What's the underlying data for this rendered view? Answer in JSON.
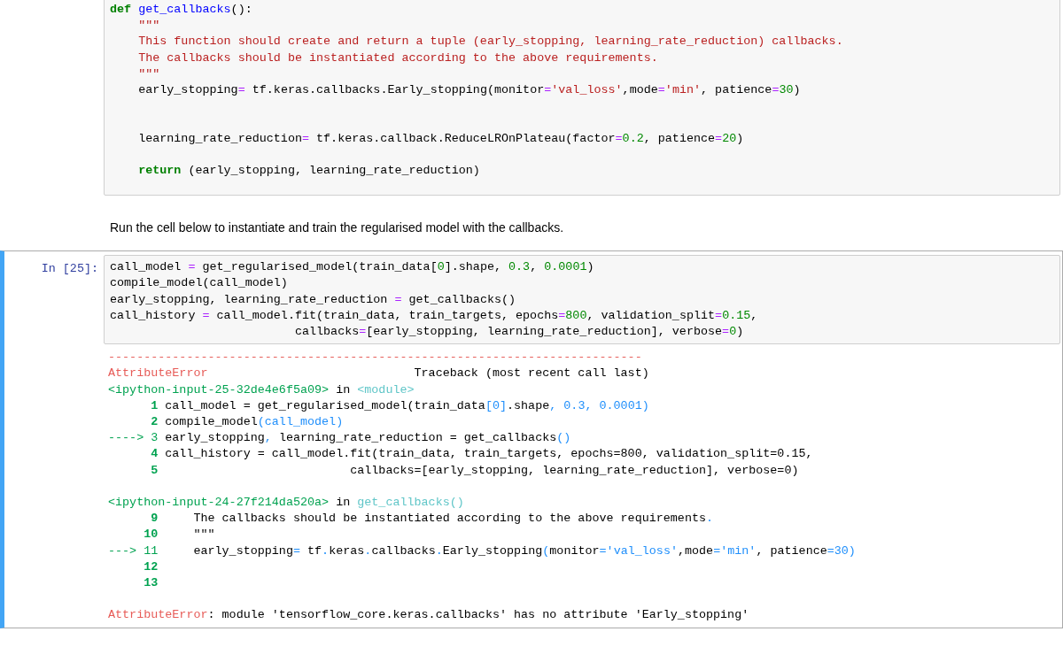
{
  "cells": [
    {
      "kind": "code",
      "selected": false,
      "lines": [
        {
          "kind": "code",
          "tokens": [
            {
              "t": "def",
              "kind": "kw"
            },
            {
              "t": " get_callbacks",
              "kind": "fn"
            },
            {
              "t": "():"
            }
          ]
        },
        {
          "kind": "code",
          "tokens": [
            {
              "t": "    \"\"\"",
              "kind": "str"
            }
          ]
        },
        {
          "kind": "code",
          "tokens": [
            {
              "t": "    This function should create and return a tuple (early_stopping, learning_rate_reduction) callbacks.",
              "kind": "str"
            }
          ]
        },
        {
          "kind": "code",
          "tokens": [
            {
              "t": "    The callbacks should be instantiated according to the above requirements.",
              "kind": "str"
            }
          ]
        },
        {
          "kind": "code",
          "tokens": [
            {
              "t": "    \"\"\"",
              "kind": "str"
            }
          ]
        },
        {
          "kind": "code",
          "tokens": [
            {
              "t": "    early_stopping"
            },
            {
              "t": "=",
              "kind": "op"
            },
            {
              "t": " tf.keras.callbacks.Early_stopping(monitor"
            },
            {
              "t": "=",
              "kind": "op"
            },
            {
              "t": "'val_loss'",
              "kind": "str"
            },
            {
              "t": ",mode"
            },
            {
              "t": "=",
              "kind": "op"
            },
            {
              "t": "'min'",
              "kind": "str"
            },
            {
              "t": ", patience"
            },
            {
              "t": "=",
              "kind": "op"
            },
            {
              "t": "30",
              "kind": "num"
            },
            {
              "t": ")"
            }
          ]
        },
        {
          "kind": "blank"
        },
        {
          "kind": "blank"
        },
        {
          "kind": "code",
          "tokens": [
            {
              "t": "    learning_rate_reduction"
            },
            {
              "t": "=",
              "kind": "op"
            },
            {
              "t": " tf.keras.callback.ReduceLROnPlateau(factor"
            },
            {
              "t": "=",
              "kind": "op"
            },
            {
              "t": "0.2",
              "kind": "num"
            },
            {
              "t": ", patience"
            },
            {
              "t": "=",
              "kind": "op"
            },
            {
              "t": "20",
              "kind": "num"
            },
            {
              "t": ")"
            }
          ]
        },
        {
          "kind": "blank"
        },
        {
          "kind": "code",
          "tokens": [
            {
              "t": "    return",
              "kind": "kw"
            },
            {
              "t": " (early_stopping, learning_rate_reduction)"
            }
          ]
        }
      ]
    },
    {
      "kind": "markdown",
      "text": "Run the cell below to instantiate and train the regularised model with the callbacks."
    },
    {
      "kind": "code",
      "selected": true,
      "prompt": "In [25]:",
      "lines": [
        {
          "kind": "code",
          "tokens": [
            {
              "t": "call_model "
            },
            {
              "t": "=",
              "kind": "op"
            },
            {
              "t": " get_regularised_model(train_data["
            },
            {
              "t": "0",
              "kind": "num"
            },
            {
              "t": "].shape, "
            },
            {
              "t": "0.3",
              "kind": "num"
            },
            {
              "t": ", "
            },
            {
              "t": "0.0001",
              "kind": "num"
            },
            {
              "t": ")"
            }
          ]
        },
        {
          "kind": "code",
          "tokens": [
            {
              "t": "compile_model(call_model)"
            }
          ]
        },
        {
          "kind": "code",
          "tokens": [
            {
              "t": "early_stopping, learning_rate_reduction "
            },
            {
              "t": "=",
              "kind": "op"
            },
            {
              "t": " get_callbacks()"
            }
          ]
        },
        {
          "kind": "code",
          "tokens": [
            {
              "t": "call_history "
            },
            {
              "t": "=",
              "kind": "op"
            },
            {
              "t": " call_model.fit(train_data, train_targets, epochs"
            },
            {
              "t": "=",
              "kind": "op"
            },
            {
              "t": "800",
              "kind": "num"
            },
            {
              "t": ", validation_split"
            },
            {
              "t": "=",
              "kind": "op"
            },
            {
              "t": "0.15",
              "kind": "num"
            },
            {
              "t": ","
            }
          ]
        },
        {
          "kind": "code",
          "tokens": [
            {
              "t": "                          callbacks"
            },
            {
              "t": "=",
              "kind": "op"
            },
            {
              "t": "[early_stopping, learning_rate_reduction], verbose"
            },
            {
              "t": "=",
              "kind": "op"
            },
            {
              "t": "0",
              "kind": "num"
            },
            {
              "t": ")"
            }
          ]
        }
      ],
      "output": [
        {
          "kind": "code",
          "tokens": [
            {
              "t": "---------------------------------------------------------------------------",
              "kind": "red"
            }
          ]
        },
        {
          "kind": "code",
          "tokens": [
            {
              "t": "AttributeError",
              "kind": "red"
            },
            {
              "t": "                             Traceback (most recent call last)"
            }
          ]
        },
        {
          "kind": "code",
          "tokens": [
            {
              "t": "<ipython-input-25-32de4e6f5a09>",
              "kind": "green"
            },
            {
              "t": " in "
            },
            {
              "t": "<module>",
              "kind": "cyan"
            }
          ]
        },
        {
          "kind": "code",
          "tokens": [
            {
              "t": "      1 ",
              "kind": "lineno"
            },
            {
              "t": "call_model = get_regularised_model(train_data"
            },
            {
              "t": "[0]",
              "kind": "blue"
            },
            {
              "t": ".shape"
            },
            {
              "t": ", 0.3, 0.0001)",
              "kind": "blue"
            }
          ]
        },
        {
          "kind": "code",
          "tokens": [
            {
              "t": "      2 ",
              "kind": "lineno"
            },
            {
              "t": "compile_model"
            },
            {
              "t": "(call_model)",
              "kind": "blue"
            }
          ]
        },
        {
          "kind": "code",
          "tokens": [
            {
              "t": "----> 3 ",
              "kind": "green"
            },
            {
              "t": "early_stopping"
            },
            {
              "t": ", ",
              "kind": "blue"
            },
            {
              "t": "learning_rate_reduction = get_callbacks"
            },
            {
              "t": "()",
              "kind": "blue"
            }
          ]
        },
        {
          "kind": "code",
          "tokens": [
            {
              "t": "      4 ",
              "kind": "lineno"
            },
            {
              "t": "call_history = call_model.fit(train_data, train_targets, epochs=800, validation_split=0.15,"
            }
          ]
        },
        {
          "kind": "code",
          "tokens": [
            {
              "t": "      5 ",
              "kind": "lineno"
            },
            {
              "t": "                          callbacks=[early_stopping, learning_rate_reduction], verbose=0)"
            }
          ]
        },
        {
          "kind": "blank"
        },
        {
          "kind": "code",
          "tokens": [
            {
              "t": "<ipython-input-24-27f214da520a>",
              "kind": "green"
            },
            {
              "t": " in "
            },
            {
              "t": "get_callbacks()",
              "kind": "cyan"
            }
          ]
        },
        {
          "kind": "code",
          "tokens": [
            {
              "t": "      9 ",
              "kind": "lineno"
            },
            {
              "t": "    The callbacks should be instantiated according to the above requirements"
            },
            {
              "t": ".",
              "kind": "blue"
            }
          ]
        },
        {
          "kind": "code",
          "tokens": [
            {
              "t": "     10 ",
              "kind": "lineno"
            },
            {
              "t": "    \"\"\""
            }
          ]
        },
        {
          "kind": "code",
          "tokens": [
            {
              "t": "---> 11 ",
              "kind": "green"
            },
            {
              "t": "    early_stopping"
            },
            {
              "t": "= ",
              "kind": "blue"
            },
            {
              "t": "tf"
            },
            {
              "t": ".",
              "kind": "blue"
            },
            {
              "t": "keras"
            },
            {
              "t": ".",
              "kind": "blue"
            },
            {
              "t": "callbacks"
            },
            {
              "t": ".",
              "kind": "blue"
            },
            {
              "t": "Early_stopping"
            },
            {
              "t": "(",
              "kind": "blue"
            },
            {
              "t": "monitor"
            },
            {
              "t": "=",
              "kind": "blue"
            },
            {
              "t": "'val_loss'",
              "kind": "blue"
            },
            {
              "t": ",mode"
            },
            {
              "t": "=",
              "kind": "blue"
            },
            {
              "t": "'min'",
              "kind": "blue"
            },
            {
              "t": ", patience"
            },
            {
              "t": "=30)",
              "kind": "blue"
            }
          ]
        },
        {
          "kind": "code",
          "tokens": [
            {
              "t": "     12",
              "kind": "lineno"
            }
          ]
        },
        {
          "kind": "code",
          "tokens": [
            {
              "t": "     13",
              "kind": "lineno"
            }
          ]
        },
        {
          "kind": "blank"
        },
        {
          "kind": "code",
          "tokens": [
            {
              "t": "AttributeError",
              "kind": "red"
            },
            {
              "t": ": module 'tensorflow_core.keras.callbacks' has no attribute 'Early_stopping'"
            }
          ]
        }
      ]
    }
  ]
}
